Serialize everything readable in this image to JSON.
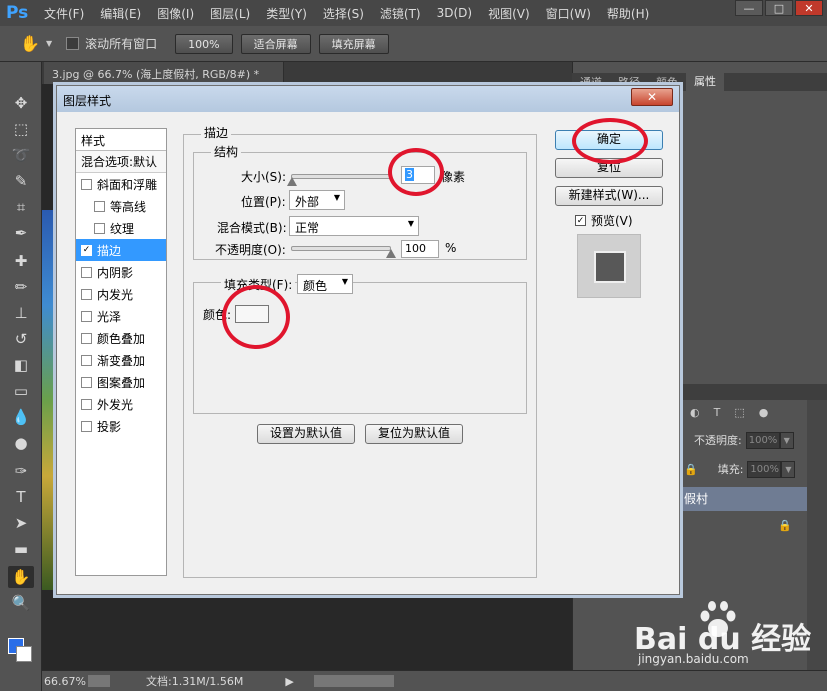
{
  "app": {
    "logo": "Ps",
    "menu": [
      "文件(F)",
      "编辑(E)",
      "图像(I)",
      "图层(L)",
      "类型(Y)",
      "选择(S)",
      "滤镜(T)",
      "3D(D)",
      "视图(V)",
      "窗口(W)",
      "帮助(H)"
    ],
    "window_buttons": [
      "—",
      "□",
      "✕"
    ]
  },
  "options_bar": {
    "scroll_all_label": "滚动所有窗口",
    "zoom_100": "100%",
    "fit_screen": "适合屏幕",
    "fill_screen": "填充屏幕"
  },
  "document": {
    "tab_title": "3.jpg @ 66.7% (海上度假村, RGB/8#) *",
    "tab_close": "×"
  },
  "right_panel": {
    "tabs": [
      "通道",
      "路径",
      "颜色",
      "属性"
    ],
    "opacity_label": "不透明度:",
    "opacity_value": "100%",
    "fill_label": "填充:",
    "fill_value": "100%",
    "layer_name": "假村"
  },
  "status": {
    "zoom": "66.67%",
    "doc_size": "文档:1.31M/1.56M"
  },
  "dialog": {
    "title": "图层样式",
    "close": "✕",
    "styles_header": "样式",
    "blend_options": "混合选项:默认",
    "style_items": [
      {
        "label": "斜面和浮雕",
        "checked": false
      },
      {
        "label": "等高线",
        "checked": false
      },
      {
        "label": "纹理",
        "checked": false
      },
      {
        "label": "描边",
        "checked": true
      },
      {
        "label": "内阴影",
        "checked": false
      },
      {
        "label": "内发光",
        "checked": false
      },
      {
        "label": "光泽",
        "checked": false
      },
      {
        "label": "颜色叠加",
        "checked": false
      },
      {
        "label": "渐变叠加",
        "checked": false
      },
      {
        "label": "图案叠加",
        "checked": false
      },
      {
        "label": "外发光",
        "checked": false
      },
      {
        "label": "投影",
        "checked": false
      }
    ],
    "stroke": {
      "section_title": "描边",
      "structure_title": "结构",
      "size_label": "大小(S):",
      "size_value": "3",
      "size_unit": "像素",
      "size_fraction": 0.01,
      "position_label": "位置(P):",
      "position_value": "外部",
      "blend_mode_label": "混合模式(B):",
      "blend_mode_value": "正常",
      "opacity_label": "不透明度(O):",
      "opacity_value": "100",
      "opacity_unit": "%",
      "opacity_fraction": 1.0,
      "fill_type_label": "填充类型(F):",
      "fill_type_value": "颜色",
      "color_label": "颜色:",
      "color_value": "#f7f7f7"
    },
    "make_default": "设置为默认值",
    "reset_default": "复位为默认值",
    "ok": "确定",
    "reset": "复位",
    "new_style": "新建样式(W)...",
    "preview_label": "预览(V)",
    "preview_checked": true
  },
  "watermark": {
    "main": "Bai du 经验",
    "sub": "jingyan.baidu.com"
  },
  "colors": {
    "accent_selection": "#3399ff",
    "annotation_red": "#e0152d",
    "ps_blue": "#3fa3ff"
  }
}
